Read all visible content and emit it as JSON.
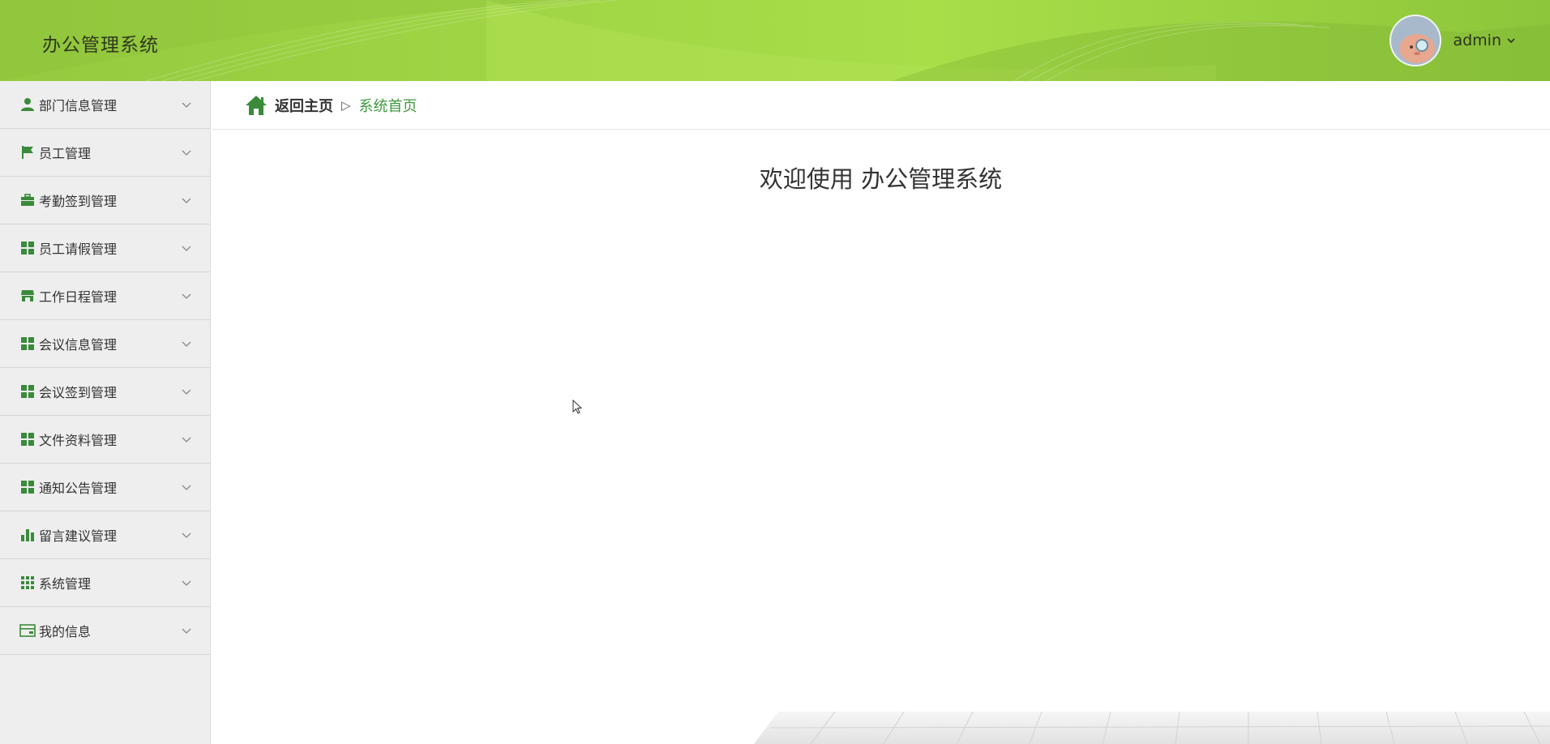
{
  "header": {
    "brand": "办公管理系统",
    "username": "admin",
    "bg_color": "#9fd445"
  },
  "sidebar": {
    "accent_color": "#3a8a3a",
    "items": [
      {
        "label": "部门信息管理",
        "icon": "user-icon"
      },
      {
        "label": "员工管理",
        "icon": "flag-icon"
      },
      {
        "label": "考勤签到管理",
        "icon": "briefcase-icon"
      },
      {
        "label": "员工请假管理",
        "icon": "grid-icon"
      },
      {
        "label": "工作日程管理",
        "icon": "shop-icon"
      },
      {
        "label": "会议信息管理",
        "icon": "grid-icon"
      },
      {
        "label": "会议签到管理",
        "icon": "grid-icon"
      },
      {
        "label": "文件资料管理",
        "icon": "grid-icon"
      },
      {
        "label": "通知公告管理",
        "icon": "grid-icon"
      },
      {
        "label": "留言建议管理",
        "icon": "bar-chart-icon"
      },
      {
        "label": "系统管理",
        "icon": "apps-icon"
      },
      {
        "label": "我的信息",
        "icon": "card-icon"
      }
    ]
  },
  "breadcrumb": {
    "home": "返回主页",
    "separator": "▷",
    "current": "系统首页"
  },
  "main": {
    "welcome": "欢迎使用 办公管理系统"
  }
}
